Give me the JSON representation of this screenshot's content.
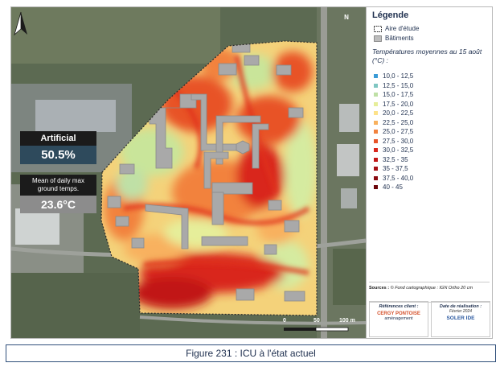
{
  "map": {
    "north_label": "N",
    "stats": {
      "artificial_label": "Artificial",
      "artificial_value": "50.5%",
      "temp_label": "Mean of daily max ground temps.",
      "temp_value": "23.6°C"
    },
    "scale": {
      "t0": "0",
      "t50": "50",
      "t100": "100 m"
    }
  },
  "legend": {
    "title": "Légende",
    "study_area": "Aire d'étude",
    "buildings": "Bâtiments",
    "temp_title": "Températures moyennes au 15 août (°C) :",
    "classes": [
      {
        "label": "10,0 - 12,5",
        "color": "#3a9bd6"
      },
      {
        "label": "12,5 - 15,0",
        "color": "#7fc6c2"
      },
      {
        "label": "15,0 - 17,5",
        "color": "#bfe0a6"
      },
      {
        "label": "17,5 - 20,0",
        "color": "#e6ee9a"
      },
      {
        "label": "20,0 - 22,5",
        "color": "#fde28a"
      },
      {
        "label": "22,5 - 25,0",
        "color": "#f8b15e"
      },
      {
        "label": "25,0 - 27,5",
        "color": "#f2823e"
      },
      {
        "label": "27,5 - 30,0",
        "color": "#e85328"
      },
      {
        "label": "30,0 - 32,5",
        "color": "#d9261c"
      },
      {
        "label": "32,5 - 35",
        "color": "#c11616"
      },
      {
        "label": "35 - 37,5",
        "color": "#a50f15"
      },
      {
        "label": "37,5 - 40,0",
        "color": "#8a0a10"
      },
      {
        "label": "40 - 45",
        "color": "#6b050a"
      }
    ],
    "sources_label": "Sources :",
    "sources_text": "© Fond cartographique : IGN Ortho 20 cm",
    "ref_title": "Références client :",
    "client_name": "CERGY PONTOISE",
    "client_sub": "aménagement",
    "date_title": "Date de réalisation :",
    "date_value": "Février 2024",
    "company": "SOLER IDE"
  },
  "caption": "Figure 231 : ICU à l'état actuel"
}
